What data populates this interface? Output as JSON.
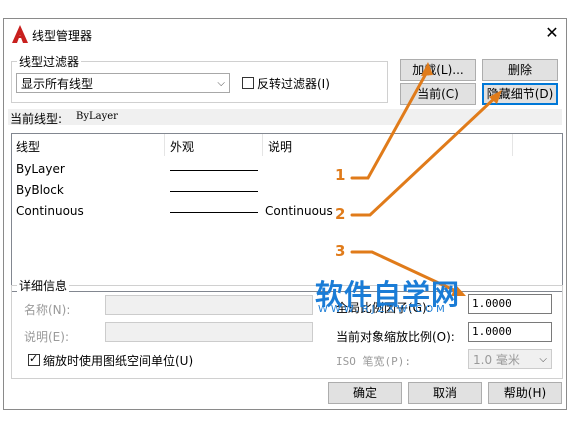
{
  "window": {
    "title": "线型管理器",
    "close": "✕"
  },
  "filter": {
    "group_title": "线型过滤器",
    "selected": "显示所有线型",
    "invert_label": "反转过滤器(I)",
    "invert_checked": false
  },
  "buttons": {
    "load": "加载(L)...",
    "delete": "删除",
    "current": "当前(C)",
    "hide_details": "隐藏细节(D)",
    "ok": "确定",
    "cancel": "取消",
    "help": "帮助(H)"
  },
  "current_linetype": {
    "label": "当前线型:",
    "value": "ByLayer"
  },
  "list": {
    "headers": [
      "线型",
      "外观",
      "说明"
    ],
    "rows": [
      {
        "name": "ByLayer",
        "desc": ""
      },
      {
        "name": "ByBlock",
        "desc": ""
      },
      {
        "name": "Continuous",
        "desc": "Continuous"
      }
    ]
  },
  "details": {
    "group_title": "详细信息",
    "name_label": "名称(N):",
    "desc_label": "说明(E):",
    "paper_space_label": "缩放时使用图纸空间单位(U)",
    "paper_space_checked": true,
    "global_scale_label": "全局比例因子(G):",
    "global_scale_value": "1.0000",
    "current_scale_label": "当前对象缩放比例(O):",
    "current_scale_value": "1.0000",
    "iso_label": "ISO 笔宽(P):",
    "iso_value": "1.0 毫米"
  },
  "annotations": {
    "n1": "1",
    "n2": "2",
    "n3": "3",
    "color": "#e07b1a"
  },
  "watermark": {
    "text": "软件自学网",
    "sub": "WWW.RJZXW.COM"
  }
}
